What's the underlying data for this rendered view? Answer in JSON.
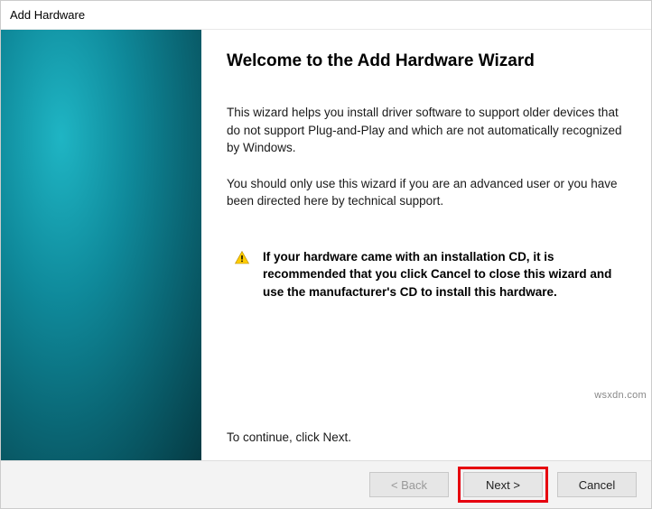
{
  "window": {
    "title": "Add Hardware"
  },
  "main": {
    "heading": "Welcome to the Add Hardware Wizard",
    "para1": "This wizard helps you install driver software to support older devices that do not support Plug-and-Play and which are not automatically recognized by Windows.",
    "para2": "You should only use this wizard if you are an advanced user or you have been directed here by technical support.",
    "warning": "If your hardware came with an installation CD, it is recommended that you click Cancel to close this wizard and use the manufacturer's CD to install this hardware.",
    "continue_hint": "To continue, click Next."
  },
  "buttons": {
    "back": "< Back",
    "next": "Next >",
    "cancel": "Cancel"
  },
  "watermark": "wsxdn.com"
}
